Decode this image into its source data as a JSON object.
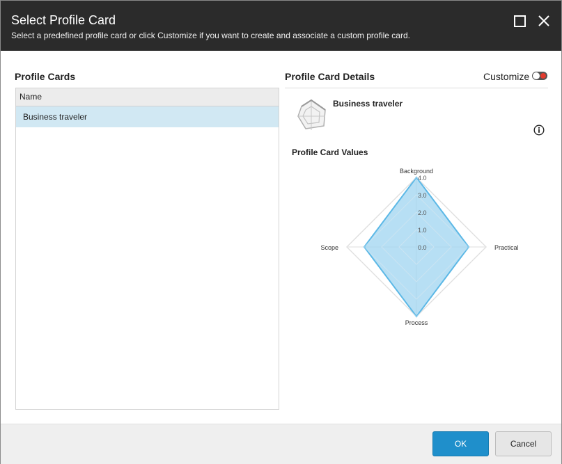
{
  "header": {
    "title": "Select Profile Card",
    "subtitle": "Select a predefined profile card or click Customize if you want to create and associate a custom profile card."
  },
  "left": {
    "title": "Profile Cards",
    "column_name": "Name",
    "rows": [
      "Business traveler"
    ]
  },
  "right": {
    "title": "Profile Card Details",
    "customize_label": "Customize",
    "selected_card": "Business traveler",
    "values_title": "Profile Card Values"
  },
  "chart_data": {
    "type": "radar",
    "axes": [
      "Background",
      "Practical",
      "Process",
      "Scope"
    ],
    "values": [
      4,
      3,
      4,
      3
    ],
    "rmin": 0,
    "rmax": 4,
    "ticks": [
      "0.0",
      "1.0",
      "2.0",
      "3.0",
      "4.0"
    ],
    "color": "#5cb8e6",
    "fill": "#9fd4f0"
  },
  "footer": {
    "ok_label": "OK",
    "cancel_label": "Cancel"
  },
  "colors": {
    "header_bg": "#2b2b2b",
    "selected_row": "#d1e8f3",
    "ok_bg": "#1f8fcb",
    "toggle_dot": "#e23b2e"
  }
}
